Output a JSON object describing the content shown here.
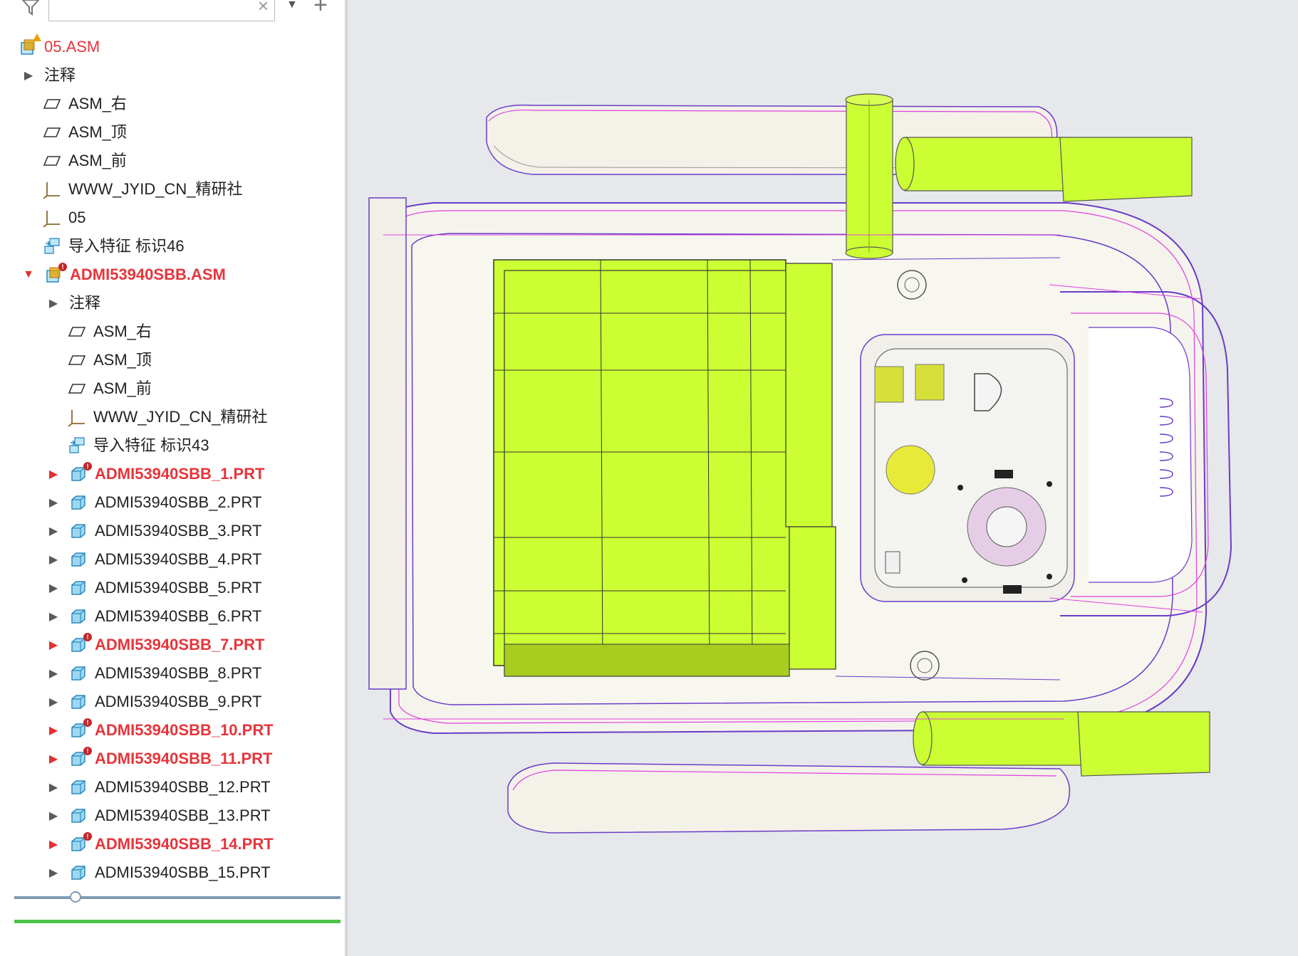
{
  "toolbar": {
    "search": {
      "value": "",
      "placeholder": ""
    },
    "clear_glyph": "×",
    "dropdown_glyph": "▼",
    "add_glyph": "+"
  },
  "tree": {
    "root": {
      "label": "05.ASM",
      "status": "warning"
    },
    "level1": [
      {
        "label": "注释",
        "type": "annotation"
      },
      {
        "label": "ASM_右",
        "type": "datum-plane"
      },
      {
        "label": "ASM_顶",
        "type": "datum-plane"
      },
      {
        "label": "ASM_前",
        "type": "datum-plane"
      },
      {
        "label": "WWW_JYID_CN_精研社",
        "type": "csys"
      },
      {
        "label": "05",
        "type": "csys"
      },
      {
        "label": "导入特征 标识46",
        "type": "import-feature"
      },
      {
        "label": "ADMI53940SBB.ASM",
        "type": "subassembly",
        "status": "error",
        "expanded": true
      }
    ],
    "level2": [
      {
        "label": "注释",
        "type": "annotation"
      },
      {
        "label": "ASM_右",
        "type": "datum-plane"
      },
      {
        "label": "ASM_顶",
        "type": "datum-plane"
      },
      {
        "label": "ASM_前",
        "type": "datum-plane"
      },
      {
        "label": "WWW_JYID_CN_精研社",
        "type": "csys"
      },
      {
        "label": "导入特征 标识43",
        "type": "import-feature"
      },
      {
        "label": "ADMI53940SBB_1.PRT",
        "type": "part",
        "status": "error"
      },
      {
        "label": "ADMI53940SBB_2.PRT",
        "type": "part"
      },
      {
        "label": "ADMI53940SBB_3.PRT",
        "type": "part"
      },
      {
        "label": "ADMI53940SBB_4.PRT",
        "type": "part"
      },
      {
        "label": "ADMI53940SBB_5.PRT",
        "type": "part"
      },
      {
        "label": "ADMI53940SBB_6.PRT",
        "type": "part"
      },
      {
        "label": "ADMI53940SBB_7.PRT",
        "type": "part",
        "status": "error"
      },
      {
        "label": "ADMI53940SBB_8.PRT",
        "type": "part"
      },
      {
        "label": "ADMI53940SBB_9.PRT",
        "type": "part"
      },
      {
        "label": "ADMI53940SBB_10.PRT",
        "type": "part",
        "status": "error"
      },
      {
        "label": "ADMI53940SBB_11.PRT",
        "type": "part",
        "status": "error"
      },
      {
        "label": "ADMI53940SBB_12.PRT",
        "type": "part"
      },
      {
        "label": "ADMI53940SBB_13.PRT",
        "type": "part"
      },
      {
        "label": "ADMI53940SBB_14.PRT",
        "type": "part",
        "status": "error"
      },
      {
        "label": "ADMI53940SBB_15.PRT",
        "type": "part"
      }
    ]
  },
  "colors": {
    "error_text": "#e5353b",
    "model_green": "#ccff33",
    "wire_purple": "#6a3cc8",
    "wire_magenta": "#e040e0"
  }
}
